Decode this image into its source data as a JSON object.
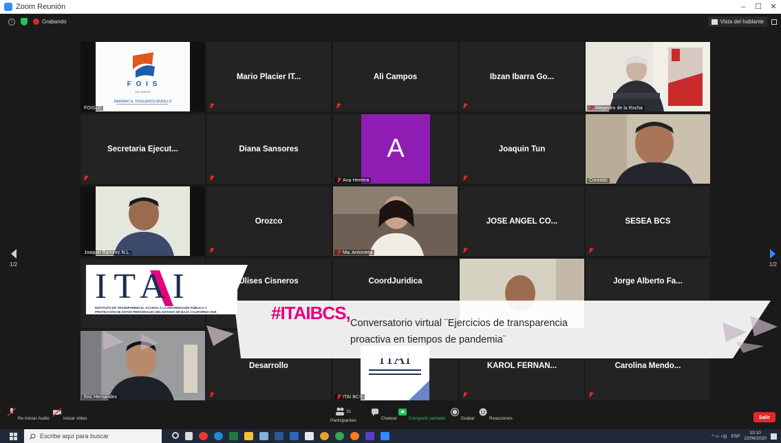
{
  "window": {
    "title": "Zoom Reunión",
    "controls": [
      "–",
      "☐",
      "✕"
    ]
  },
  "status": {
    "recording_label": "Grabando",
    "view_button": "Vista del hablante"
  },
  "pager": {
    "left_page": "1/2",
    "right_page": "1/2"
  },
  "tiles": [
    {
      "name": "FOISLC",
      "type": "video"
    },
    {
      "name": "Mario Placier IT...",
      "type": "label"
    },
    {
      "name": "Ali Campos",
      "type": "label"
    },
    {
      "name": "Ibzan Ibarra Go...",
      "type": "label"
    },
    {
      "name": "Alejandro de la Rocha",
      "type": "video"
    },
    {
      "name": "Secretaria Ejecut...",
      "type": "label"
    },
    {
      "name": "Diana Sansores",
      "type": "label"
    },
    {
      "name": "Ana Herrera",
      "type": "avatar",
      "initial": "A"
    },
    {
      "name": "Joaquin Tun",
      "type": "label"
    },
    {
      "name": "Conrado",
      "type": "video"
    },
    {
      "name": "Joaquin Ramirez N.L.",
      "type": "video"
    },
    {
      "name": "Orozco",
      "type": "label"
    },
    {
      "name": "Ma. Antonieta",
      "type": "video"
    },
    {
      "name": "JOSE ANGEL CO...",
      "type": "label"
    },
    {
      "name": "SESEA BCS",
      "type": "label"
    },
    {
      "name": "Ulises Cisneros",
      "type": "label"
    },
    {
      "name": "CoordJuridica",
      "type": "label"
    },
    {
      "name": "Jorge Alberto Fa...",
      "type": "label"
    },
    {
      "name": "Eric Hernandez",
      "type": "video"
    },
    {
      "name": "Desarrollo",
      "type": "label"
    },
    {
      "name": "ITAI BCS",
      "type": "video"
    },
    {
      "name": "KAROL FERNAN...",
      "type": "label"
    },
    {
      "name": "Carolina Mendo...",
      "type": "label"
    }
  ],
  "fois_card": {
    "title": "F O I S",
    "subtitle": "100 OBROS",
    "person": "MARIANO A. TRIGUEROS MURILLO"
  },
  "banner": {
    "logo": "ITAI",
    "logo_caption_1": "INSTITUTO DE TRANSPARENCIA, ACCESO A LA INFORMACIÓN PÚBLICA Y",
    "logo_caption_2": "PROTECCIÓN DE DATOS PERSONALES DEL ESTADO DE BAJA CALIFORNIA SUR",
    "hashtag": "#ITAIBCS,",
    "text_line1": "Conversatorio virtual ¨Ejercicios de transparencia",
    "text_line2": "proactiva en tiempos de pandemia¨"
  },
  "toolbar": {
    "audio": "Re-Iniciar Audio",
    "video": "Iniciar video",
    "participants": "Participantes",
    "participants_count": "31",
    "chat": "Chatear",
    "share": "Compartir pantalla",
    "record": "Grabar",
    "reactions": "Reacciones",
    "leave": "Salir"
  },
  "taskbar": {
    "search_placeholder": "Escribe aquí para buscar",
    "lang": "ESP",
    "time": "10:10",
    "date": "22/06/2020"
  },
  "colors": {
    "zoom_blue": "#2d8cff",
    "active_speaker": "#c9e04e",
    "leave_red": "#e02828",
    "banner_pink": "#e5007e",
    "avatar_purple": "#8f1db3"
  }
}
